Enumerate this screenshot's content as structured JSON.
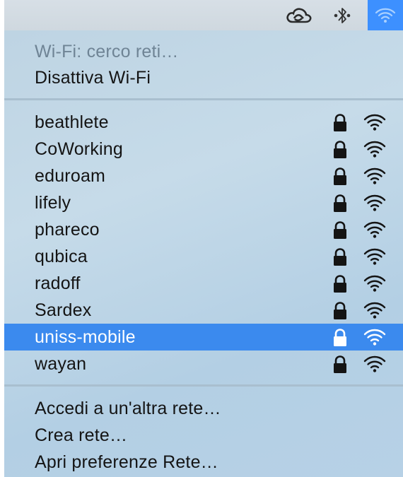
{
  "menubar": {
    "icons": [
      "creative-cloud-icon",
      "bluetooth-icon",
      "wifi-icon"
    ]
  },
  "wifi_menu": {
    "status": "Wi-Fi: cerco reti…",
    "toggle_label": "Disattiva Wi-Fi",
    "networks": [
      {
        "name": "beathlete",
        "secured": true,
        "selected": false
      },
      {
        "name": "CoWorking",
        "secured": true,
        "selected": false
      },
      {
        "name": "eduroam",
        "secured": true,
        "selected": false
      },
      {
        "name": "lifely",
        "secured": true,
        "selected": false
      },
      {
        "name": "phareco",
        "secured": true,
        "selected": false
      },
      {
        "name": "qubica",
        "secured": true,
        "selected": false
      },
      {
        "name": "radoff",
        "secured": true,
        "selected": false
      },
      {
        "name": "Sardex",
        "secured": true,
        "selected": false
      },
      {
        "name": "uniss-mobile",
        "secured": true,
        "selected": true
      },
      {
        "name": "wayan",
        "secured": true,
        "selected": false
      }
    ],
    "actions": {
      "join_other": "Accedi a un'altra rete…",
      "create_network": "Crea rete…",
      "open_prefs": "Apri preferenze Rete…"
    }
  },
  "colors": {
    "highlight": "#3b8aee",
    "menubar_wifi_active": "#3d90ff",
    "menu_background": "#bed4e3",
    "text": "#141414",
    "status_text": "#6f8495"
  }
}
